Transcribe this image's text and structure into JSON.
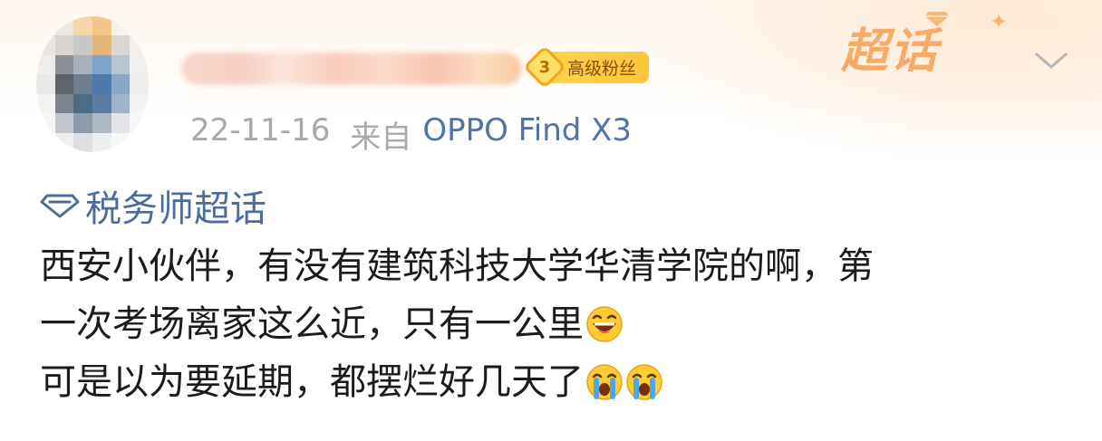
{
  "header": {
    "fan_level": "3",
    "fan_label": "高级粉丝",
    "logo_text": "超话"
  },
  "meta": {
    "date": "22-11-16",
    "from_label": "来自",
    "device": "OPPO Find X3"
  },
  "topic": {
    "name": "税务师超话",
    "icon": "diamond-icon"
  },
  "post": {
    "line1": "西安小伙伴，有没有建筑科技大学华清学院的啊，第",
    "line2": "一次考场离家这么近，只有一公里",
    "line3": "可是以为要延期，都摆烂好几天了",
    "emoji_line2": "laughing-tears-emoji",
    "emoji_line3": [
      "crying-emoji",
      "crying-emoji"
    ]
  },
  "colors": {
    "topic_blue": "#4d6c9c",
    "device_blue": "#5273a3",
    "meta_gray": "#a9a9a9",
    "badge_gold": "#ffc53a",
    "logo_orange": "#f7a862"
  }
}
